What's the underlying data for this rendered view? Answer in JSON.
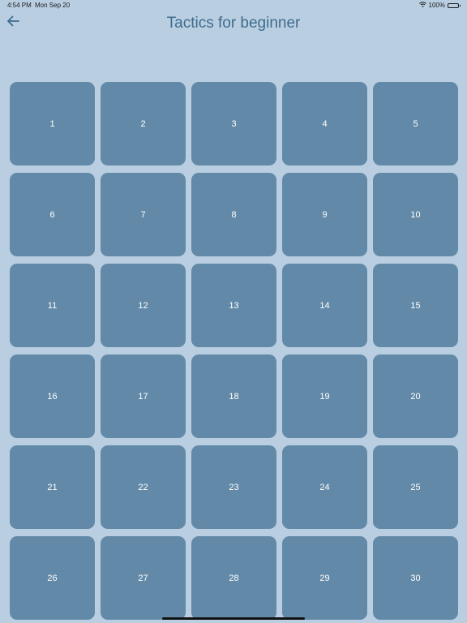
{
  "status_bar": {
    "time": "4:54 PM",
    "date": "Mon Sep 20",
    "battery": "100%"
  },
  "nav": {
    "title": "Tactics for beginner",
    "back_icon": "arrow-left-icon"
  },
  "levels": [
    "1",
    "2",
    "3",
    "4",
    "5",
    "6",
    "7",
    "8",
    "9",
    "10",
    "11",
    "12",
    "13",
    "14",
    "15",
    "16",
    "17",
    "18",
    "19",
    "20",
    "21",
    "22",
    "23",
    "24",
    "25",
    "26",
    "27",
    "28",
    "29",
    "30"
  ],
  "colors": {
    "background": "#b9cfe1",
    "tile": "#628aa8",
    "title": "#3f6b8e"
  }
}
